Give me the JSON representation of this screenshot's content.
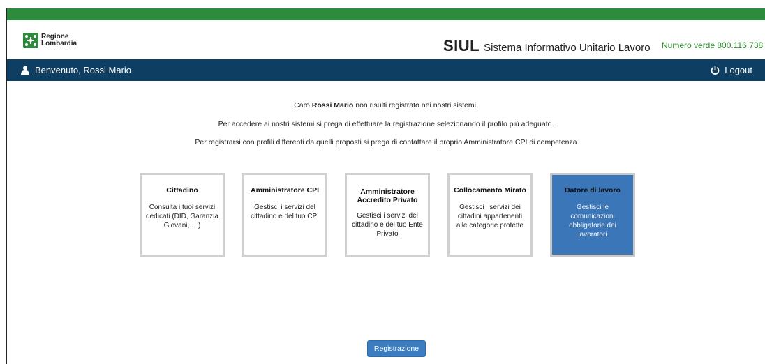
{
  "header": {
    "logo_line1": "Regione",
    "logo_line2": "Lombardia",
    "app_name": "SIUL",
    "app_full_name": "Sistema Informativo Unitario Lavoro",
    "numero_verde": "Numero verde 800.116.738"
  },
  "navbar": {
    "welcome": "Benvenuto, Rossi Mario",
    "logout": "Logout"
  },
  "messages": {
    "line1_prefix": "Caro ",
    "line1_name": "Rossi Mario",
    "line1_suffix": " non risulti registrato nei nostri sistemi.",
    "line2": "Per accedere ai nostri sistemi si prega di effettuare la registrazione selezionando il profilo più adeguato.",
    "line3": "Per registrarsi con profili differenti da quelli proposti si prega di contattare il proprio Amministratore CPI di competenza"
  },
  "profiles": [
    {
      "title": "Cittadino",
      "description": "Consulta i tuoi servizi dedicati (DID, Garanzia Giovani,… )",
      "selected": false
    },
    {
      "title": "Amministratore CPI",
      "description": "Gestisci i servizi del cittadino e del tuo CPI",
      "selected": false
    },
    {
      "title": "Amministratore Accredito Privato",
      "description": "Gestisci i servizi del cittadino e del tuo Ente Privato",
      "selected": false
    },
    {
      "title": "Collocamento Mirato",
      "description": "Gestisci i servizi dei cittadini appartenenti alle categorie protette",
      "selected": false
    },
    {
      "title": "Datore di lavoro",
      "description": "Gestisci le comunicazioni obbligatorie dei lavoratori",
      "selected": true
    }
  ],
  "actions": {
    "register_label": "Registrazione"
  },
  "colors": {
    "brand_green": "#2e8b3e",
    "navbar_blue": "#0e3f62",
    "selected_card": "#3b76b8",
    "button_blue": "#3b7dc0",
    "numero_verde_green": "#2a8a2a"
  }
}
